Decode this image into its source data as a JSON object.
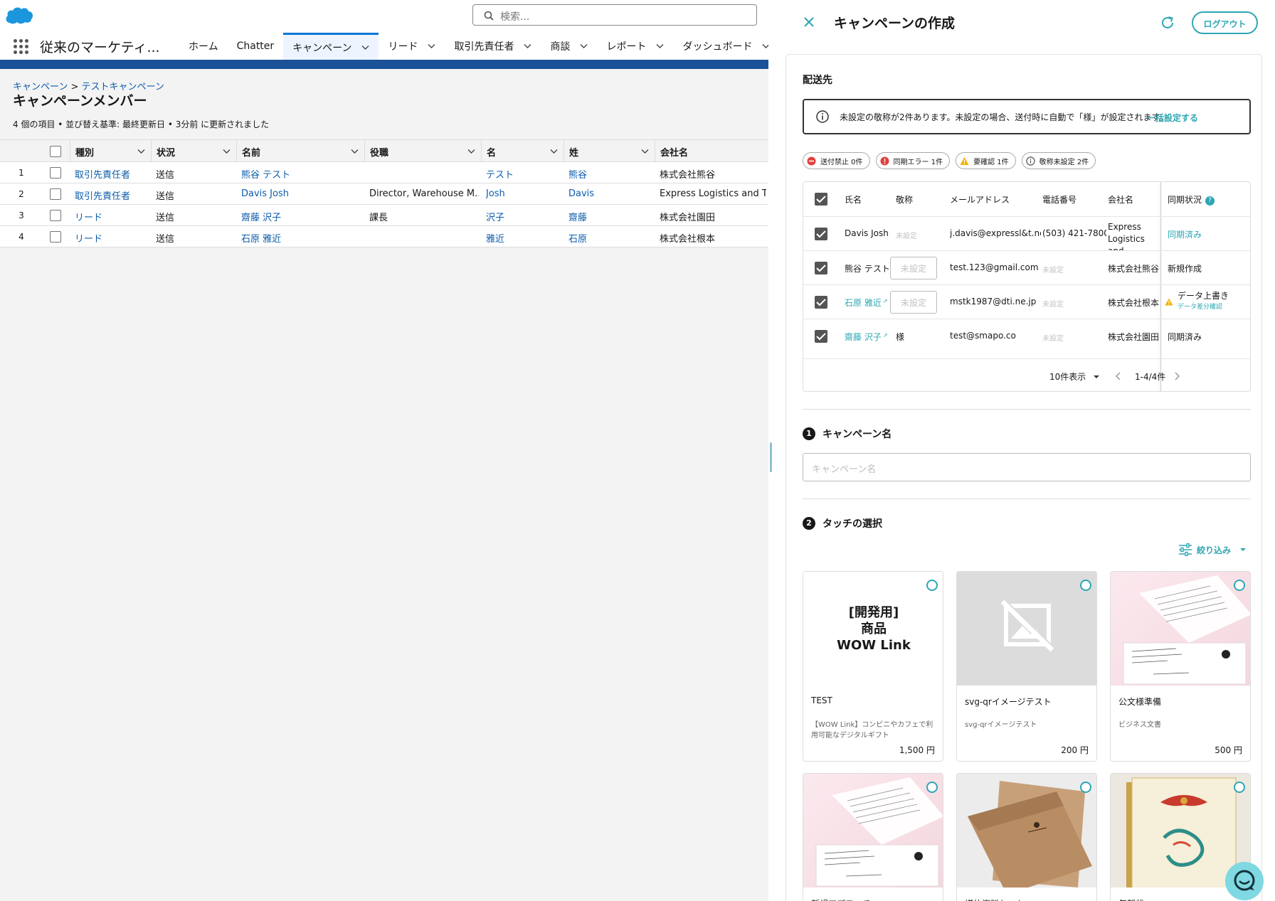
{
  "search": {
    "placeholder": "検索..."
  },
  "app": {
    "name": "従来のマーケティ..."
  },
  "nav": {
    "tabs": [
      {
        "label": "ホーム",
        "has_menu": false
      },
      {
        "label": "Chatter",
        "has_menu": false
      },
      {
        "label": "キャンペーン",
        "has_menu": true,
        "active": true
      },
      {
        "label": "リード",
        "has_menu": true
      },
      {
        "label": "取引先責任者",
        "has_menu": true
      },
      {
        "label": "商談",
        "has_menu": true
      },
      {
        "label": "レポート",
        "has_menu": true
      },
      {
        "label": "ダッシュボード",
        "has_menu": true
      }
    ]
  },
  "left": {
    "breadcrumb": {
      "parent": "キャンペーン",
      "separator": ">",
      "child": "テストキャンペーン"
    },
    "title": "キャンペーンメンバー",
    "meta": "4 個の項目 • 並び替え基準: 最終更新日 • 3分前 に更新されました",
    "columns": [
      "種別",
      "状況",
      "名前",
      "役職",
      "名",
      "姓",
      "会社名"
    ],
    "rows": [
      {
        "num": "1",
        "type": "取引先責任者",
        "status": "送信",
        "name": "熊谷 テスト",
        "title": "",
        "first": "テスト",
        "last": "熊谷",
        "company": "株式会社熊谷"
      },
      {
        "num": "2",
        "type": "取引先責任者",
        "status": "送信",
        "name": "Davis Josh",
        "title": "Director, Warehouse M...",
        "first": "Josh",
        "last": "Davis",
        "company": "Express Logistics and T"
      },
      {
        "num": "3",
        "type": "リード",
        "status": "送信",
        "name": "齋藤 沢子",
        "title": "課長",
        "first": "沢子",
        "last": "齋藤",
        "company": "株式会社園田"
      },
      {
        "num": "4",
        "type": "リード",
        "status": "送信",
        "name": "石原 雅近",
        "title": "",
        "first": "雅近",
        "last": "石原",
        "company": "株式会社根本"
      }
    ]
  },
  "panel": {
    "title": "キャンペーンの作成",
    "logout": "ログアウト",
    "section_title": "配送先",
    "info": {
      "message": "未設定の敬称が2件あります。未設定の場合、送付時に自動で「様」が設定されます。",
      "action": "一括設定する"
    },
    "chips": [
      {
        "label": "送付禁止 0件",
        "color": "#e0403c",
        "kind": "minus"
      },
      {
        "label": "同期エラー 1件",
        "color": "#e0403c",
        "kind": "alert"
      },
      {
        "label": "要確認 1件",
        "color": "#f2b200",
        "kind": "warn"
      },
      {
        "label": "敬称未設定 2件",
        "color": "#555555",
        "kind": "info"
      }
    ],
    "table": {
      "columns": [
        "氏名",
        "敬称",
        "メールアドレス",
        "電話番号",
        "会社名",
        "同期状況"
      ],
      "rows": [
        {
          "name": "Davis Josh",
          "name_link": false,
          "honorific": "未設定",
          "honorific_input": false,
          "email": "j.davis@expressl&t.net",
          "phone": "(503) 421-7800",
          "company": "Express Logistics and Transport",
          "sync": "同期済み",
          "sync_style": "teal"
        },
        {
          "name": "熊谷 テスト",
          "name_link": false,
          "honorific": "未設定",
          "honorific_input": true,
          "email": "test.123@gmail.com",
          "phone": "未設定",
          "company": "株式会社熊谷",
          "sync": "新規作成",
          "sync_style": "plain"
        },
        {
          "name": "石原 雅近",
          "name_link": true,
          "honorific": "未設定",
          "honorific_input": true,
          "email": "mstk1987@dti.ne.jp",
          "phone": "未設定",
          "company": "株式会社根本",
          "sync": "データ上書き",
          "sync_sub": "データ差分確認",
          "sync_style": "warn"
        },
        {
          "name": "齋藤 沢子",
          "name_link": true,
          "honorific": "様",
          "honorific_input": false,
          "email": "test@smapo.co",
          "phone": "未設定",
          "company": "株式会社園田",
          "sync": "同期済み",
          "sync_style": "plain"
        }
      ],
      "page_size": "10件表示",
      "range": "1-4/4件"
    },
    "step1": {
      "num": "1",
      "title": "キャンペーン名",
      "placeholder": "キャンペーン名"
    },
    "step2": {
      "num": "2",
      "title": "タッチの選択",
      "filter": "絞り込み"
    },
    "cards": [
      {
        "title": "TEST",
        "desc": "【WOW Link】コンビニやカフェで利用可能なデジタルギフト",
        "price": "1,500 円",
        "image_text": [
          "[開発用]",
          "商品",
          "WOW Link"
        ],
        "kind": "text"
      },
      {
        "title": "svg-qrイメージテスト",
        "desc": "svg-qrイメージテスト",
        "price": "200 円",
        "kind": "noimage"
      },
      {
        "title": "公文様準備",
        "desc": "ビジネス文書",
        "price": "500 円",
        "kind": "letter"
      },
      {
        "title": "新規アプローチ",
        "desc": "",
        "price": "",
        "kind": "letter"
      },
      {
        "title": "媒体資料セット",
        "desc": "",
        "price": "",
        "kind": "envelope"
      },
      {
        "title": "年賀状",
        "desc": "",
        "price": "",
        "kind": "nengajo"
      }
    ]
  },
  "colors": {
    "accent": "#2da7b3",
    "sf_blue": "#0176d3",
    "band": "#1b5297",
    "link": "#0b5cab"
  }
}
